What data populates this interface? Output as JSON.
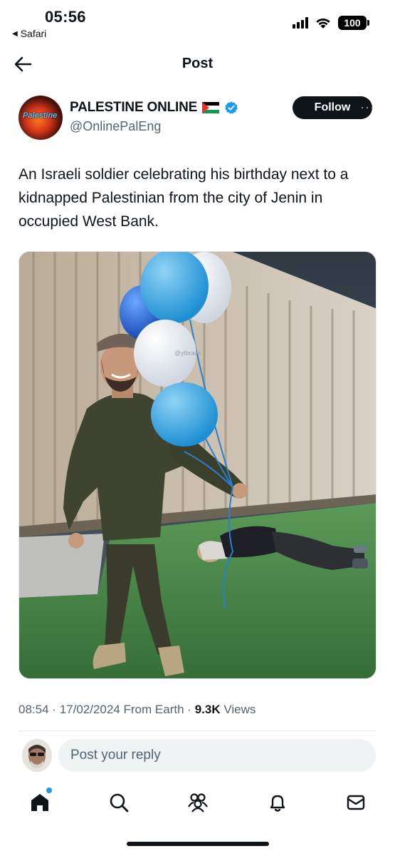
{
  "status_bar": {
    "time": "05:56",
    "back_app": "Safari",
    "battery": "100"
  },
  "header": {
    "title": "Post"
  },
  "author": {
    "display_name": "PALESTINE ONLINE",
    "handle": "@OnlinePalEng",
    "avatar_text": "Palestine",
    "follow_label": "Follow",
    "more_label": "···",
    "verified": true
  },
  "tweet": {
    "text": "An Israeli soldier celebrating his birthday next to a kidnapped Palestinian from the city of Jenin in occupied West Bank."
  },
  "media": {
    "watermark": "@ylbrawl"
  },
  "meta": {
    "time": "08:54",
    "date": "17/02/2024",
    "source": "From Earth",
    "views_count": "9.3K",
    "views_label": "Views",
    "separator": "·"
  },
  "reply": {
    "placeholder": "Post your reply"
  },
  "tabbar": {
    "items": [
      "home-icon",
      "search-icon",
      "communities-icon",
      "notifications-icon",
      "messages-icon"
    ],
    "active": "home-icon",
    "accent": "#1d9bf0"
  }
}
